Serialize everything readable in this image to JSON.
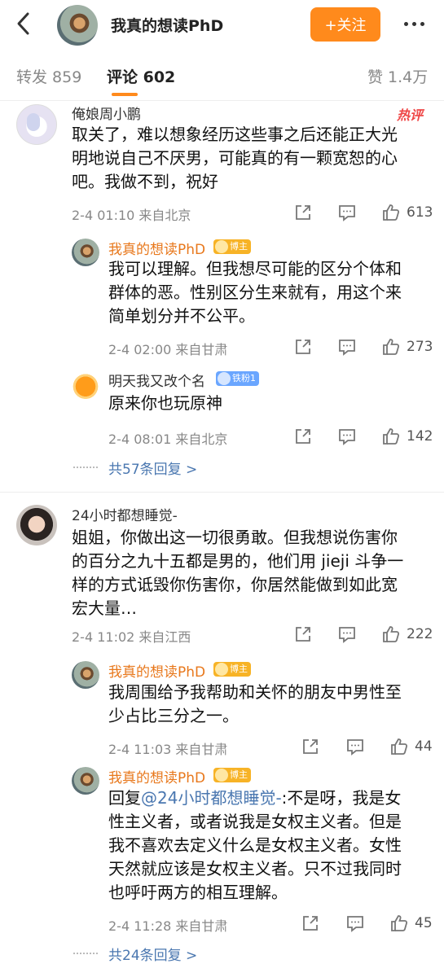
{
  "header": {
    "title": "我真的想读PhD",
    "follow_label": "+关注"
  },
  "tabs": [
    {
      "label": "转发 859"
    },
    {
      "label": "评论 602"
    },
    {
      "label": "赞 1.4万"
    }
  ],
  "comments": [
    {
      "user": "俺娘周小鹏",
      "hot_label": "热评",
      "text": [
        "取关了，难以想象经历这些事之后还能正大光",
        "明地说自己不厌男，可能真的有一颗宽恕的心",
        "吧。我做不到，祝好"
      ],
      "time_location": "2-4 01:10  来自北京",
      "likes": "613",
      "replies": [
        {
          "user": "我真的想读PhD",
          "badge": "博主",
          "text": [
            "我可以理解。但我想尽可能的区分个体和",
            "群体的恶。性别区分生来就有，用这个来",
            "简单划分并不公平。"
          ],
          "time_location": "2-4 02:00  来自甘肃",
          "likes": "273"
        },
        {
          "user": "明天我又改个名",
          "badge": "铁粉1",
          "text": [
            "原来你也玩原神"
          ],
          "time_location": "2-4 08:01  来自北京",
          "likes": "142"
        }
      ],
      "more_replies": "共57条回复 >"
    },
    {
      "user": "24小时都想睡觉-",
      "text": [
        "姐姐，你做出这一切很勇敢。但我想说伤害你",
        "的百分之九十五都是男的，他们用 jieji 斗争一",
        "样的方式诋毁你伤害你，你居然能做到如此宽",
        "宏大量…"
      ],
      "time_location": "2-4 11:02  来自江西",
      "likes": "222",
      "replies": [
        {
          "user": "我真的想读PhD",
          "badge": "博主",
          "text": [
            "我周围给予我帮助和关怀的朋友中男性至",
            "少占比三分之一。"
          ],
          "time_location": "2-4 11:03  来自甘肃",
          "likes": "44"
        },
        {
          "user": "我真的想读PhD",
          "badge": "博主",
          "reply_prefix": "回复",
          "mention": "@24小时都想睡觉-",
          "text_first_rest": ":不是呀，我是女",
          "text": [
            "性主义者，或者说我是女权主义者。但是",
            "我不喜欢去定义什么是女权主义者。女性",
            "天然就应该是女权主义者。只不过我同时",
            "也呼吁两方的相互理解。"
          ],
          "time_location": "2-4 11:28  来自甘肃",
          "likes": "45"
        }
      ],
      "more_replies": "共24条回复 >"
    }
  ],
  "icons": {
    "back": "chevron-left-icon",
    "more": "more-dots-icon",
    "share": "share-icon",
    "comment": "comment-icon",
    "like": "thumbs-up-icon"
  },
  "colors": {
    "accent": "#ff8a1c",
    "author_name": "#e8781c",
    "link": "#4a77b0",
    "hot": "#ef4747"
  }
}
